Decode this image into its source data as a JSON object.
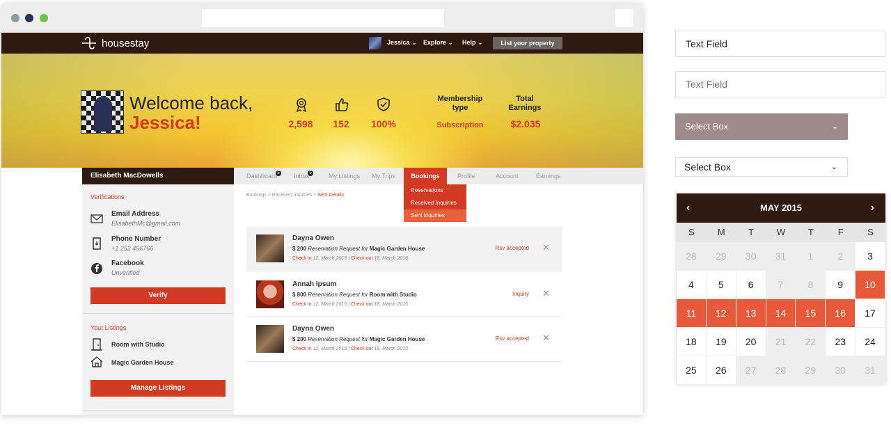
{
  "app": {
    "logo_text": "housestay",
    "nav": {
      "user": "Jessica ⌄",
      "explore": "Explore ⌄",
      "help": "Help ⌄",
      "list_property": "List your property"
    }
  },
  "hero": {
    "welcome_line1": "Welcome back,",
    "welcome_name": "Jessica!",
    "stats": [
      {
        "icon": "award-icon",
        "value": "2,598"
      },
      {
        "icon": "thumbs-up-icon",
        "value": "152"
      },
      {
        "icon": "verified-shield-icon",
        "value": "100%"
      }
    ],
    "membership": {
      "label1": "Membership",
      "label2": "type",
      "value": "Subscription"
    },
    "earnings": {
      "label1": "Total",
      "label2": "Earnings",
      "value": "$2.035"
    }
  },
  "left_panel": {
    "user_name": "Elisabeth MacDowells",
    "verifications_title": "Verifications",
    "email": {
      "title": "Email Address",
      "value": "ElisabethMc@gmail.com"
    },
    "phone": {
      "title": "Phone Number",
      "value": "+1 252 456766"
    },
    "facebook": {
      "title": "Facebook",
      "value": "Unverified"
    },
    "verify_button": "Verify",
    "listings_title": "Your Listings",
    "listings": [
      "Room with Studio",
      "Magic Garden House"
    ],
    "manage_button": "Manage Listings"
  },
  "tabs": {
    "items": [
      {
        "label": "Dashboard",
        "badge": "5"
      },
      {
        "label": "Inbox",
        "badge": "5"
      },
      {
        "label": "My Listings"
      },
      {
        "label": "My Trips"
      },
      {
        "label": "Bookings"
      },
      {
        "label": "Profile"
      },
      {
        "label": "Account"
      },
      {
        "label": "Earnings"
      }
    ],
    "dropdown": [
      "Reservations",
      "Received Inquiries",
      "Sent Inquiries"
    ]
  },
  "breadcrumb": {
    "path": "Bookings > Received Inquiries > ",
    "current": "Sent Details"
  },
  "bookings": [
    {
      "name": "Dayna Owen",
      "amount": "$ 200",
      "request": "Reservation Request for",
      "property": "Magic Garden House",
      "checkin_label": "Check In",
      "checkin": "12, March 2015",
      "checkout_label": "Check out",
      "checkout": "18, March 2015",
      "status": "Rsv accepted"
    },
    {
      "name": "Annah Ipsum",
      "amount": "$ 800",
      "request": "Reservation Request for",
      "property": "Room with Studio",
      "checkin_label": "Check In",
      "checkin": "12, March 2015",
      "checkout_label": "Check out",
      "checkout": "18, March 2015",
      "status": "Inquiry"
    },
    {
      "name": "Dayna Owen",
      "amount": "$ 200",
      "request": "Reservation Request for",
      "property": "Magic Garden House",
      "checkin_label": "Check In",
      "checkin": "12, March 2015",
      "checkout_label": "Check out",
      "checkout": "18, March 2015",
      "status": "Rsv accepted"
    }
  ],
  "widgets": {
    "text_field_value": "Text Field",
    "text_field_placeholder": "Text Field",
    "select_box_1": "Select Box",
    "select_box_2": "Select Box"
  },
  "calendar": {
    "title": "MAY 2015",
    "prev": "‹",
    "next": "›",
    "weekdays": [
      "S",
      "M",
      "T",
      "W",
      "T",
      "F",
      "S"
    ],
    "weeks": [
      [
        {
          "d": "28",
          "s": "muted"
        },
        {
          "d": "29",
          "s": "muted"
        },
        {
          "d": "30",
          "s": "muted"
        },
        {
          "d": "31",
          "s": "muted"
        },
        {
          "d": "1",
          "s": "muted"
        },
        {
          "d": "2",
          "s": "muted"
        },
        {
          "d": "3",
          "s": ""
        }
      ],
      [
        {
          "d": "4",
          "s": ""
        },
        {
          "d": "5",
          "s": ""
        },
        {
          "d": "6",
          "s": ""
        },
        {
          "d": "7",
          "s": "muted"
        },
        {
          "d": "8",
          "s": "muted"
        },
        {
          "d": "9",
          "s": ""
        },
        {
          "d": "10",
          "s": "sel"
        }
      ],
      [
        {
          "d": "11",
          "s": "sel"
        },
        {
          "d": "12",
          "s": "sel"
        },
        {
          "d": "13",
          "s": "sel"
        },
        {
          "d": "14",
          "s": "sel"
        },
        {
          "d": "15",
          "s": "sel"
        },
        {
          "d": "16",
          "s": "sel"
        },
        {
          "d": "17",
          "s": ""
        }
      ],
      [
        {
          "d": "18",
          "s": ""
        },
        {
          "d": "19",
          "s": ""
        },
        {
          "d": "20",
          "s": ""
        },
        {
          "d": "21",
          "s": "muted"
        },
        {
          "d": "22",
          "s": "muted"
        },
        {
          "d": "23",
          "s": ""
        },
        {
          "d": "24",
          "s": ""
        }
      ],
      [
        {
          "d": "25",
          "s": ""
        },
        {
          "d": "26",
          "s": ""
        },
        {
          "d": "27",
          "s": "muted"
        },
        {
          "d": "28",
          "s": "muted"
        },
        {
          "d": "29",
          "s": "muted"
        },
        {
          "d": "30",
          "s": "muted"
        },
        {
          "d": "31",
          "s": "muted"
        }
      ]
    ]
  },
  "colors": {
    "brand_dark": "#2e1a10",
    "accent": "#d23a24",
    "calendar_selected": "#e8583a",
    "select_fill": "#9e8a8a"
  }
}
